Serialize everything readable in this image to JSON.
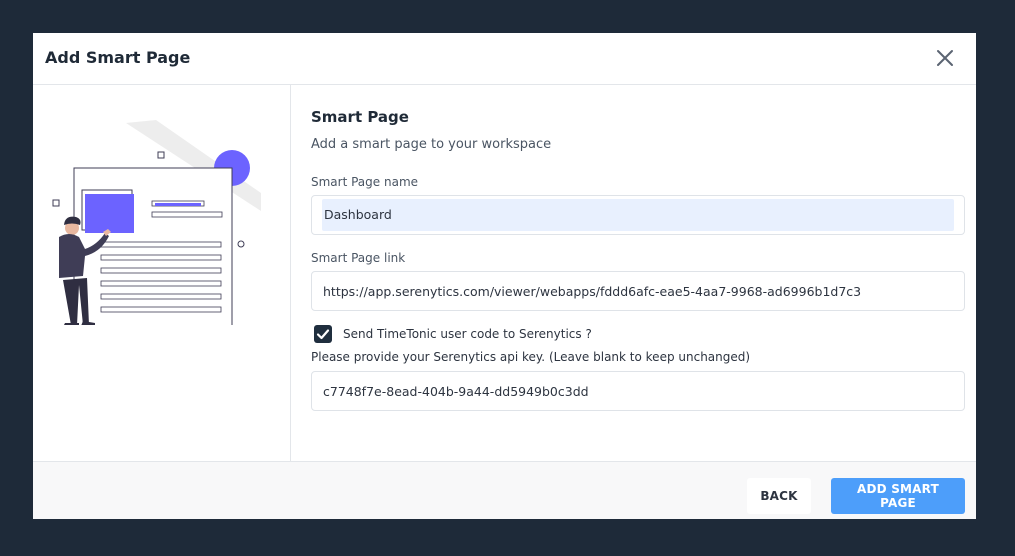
{
  "modal": {
    "title": "Add Smart Page",
    "close_icon": "close-icon"
  },
  "form": {
    "section_title": "Smart Page",
    "section_subtitle": "Add a smart page to your workspace",
    "name_label": "Smart Page name",
    "name_value": "Dashboard",
    "link_label": "Smart Page link",
    "link_value": "https://app.serenytics.com/viewer/webapps/fddd6afc-eae5-4aa7-9968-ad6996b1d7c3",
    "checkbox_checked": true,
    "checkbox_label": "Send TimeTonic user code to Serenytics ?",
    "api_key_hint": "Please provide your Serenytics api key. (Leave blank to keep unchanged)",
    "api_key_value": "c7748f7e-8ead-404b-9a44-dd5949b0c3dd"
  },
  "footer": {
    "back_label": "BACK",
    "add_label": "ADD SMART PAGE"
  },
  "colors": {
    "backdrop": "#1e2a39",
    "accent": "#4d9efa",
    "illustration_accent": "#6c63ff",
    "checkbox": "#1f2e3e"
  }
}
